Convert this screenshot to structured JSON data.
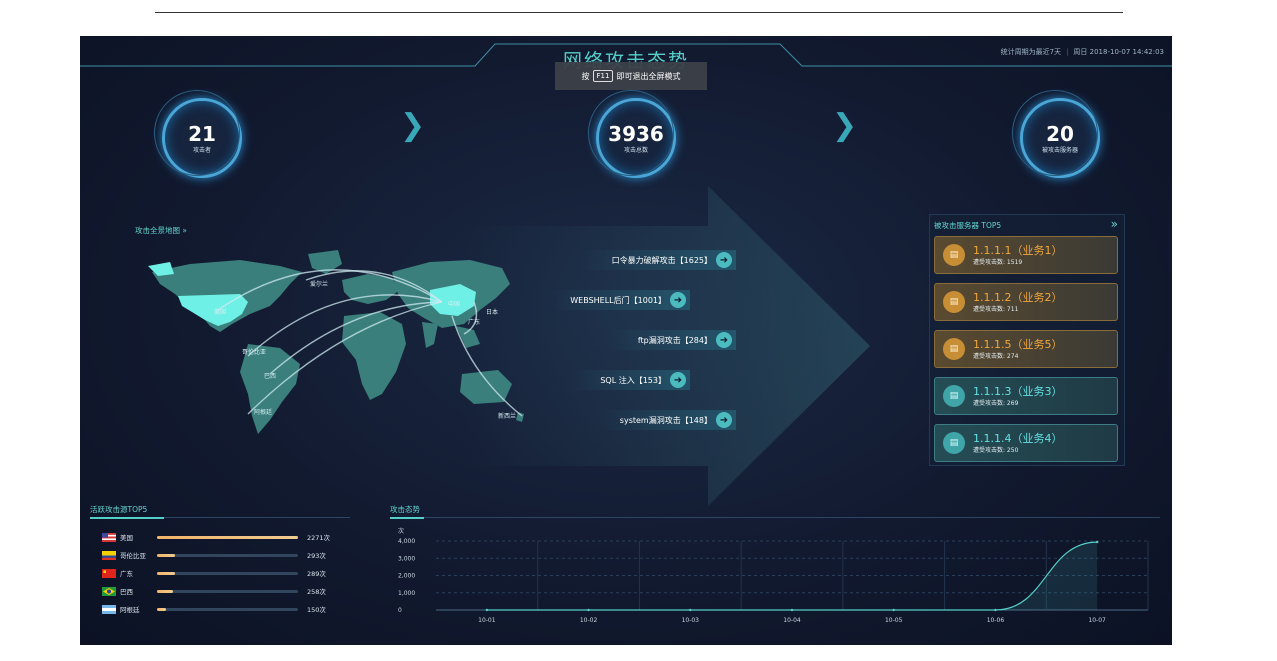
{
  "dashboard": {
    "title": "网络攻击态势",
    "stat_period": "统计周期为最近7天",
    "datetime": "周日 2018-10-07 14:42:03",
    "fullscreen_tip": {
      "prefix": "按",
      "key": "F11",
      "suffix": "即可退出全屏模式"
    }
  },
  "stats": [
    {
      "value": "21",
      "label": "攻击者"
    },
    {
      "value": "3936",
      "label": "攻击总数"
    },
    {
      "value": "20",
      "label": "被攻击服务器"
    }
  ],
  "map": {
    "title": "攻击全景地图",
    "places": [
      "美国",
      "爱尔兰",
      "中国",
      "日本",
      "广东",
      "哥伦比亚",
      "巴西",
      "阿根廷",
      "新西兰"
    ]
  },
  "attack_types": [
    {
      "label": "口令暴力破解攻击【1625】"
    },
    {
      "label": "WEBSHELL后门【1001】"
    },
    {
      "label": "ftp漏洞攻击【284】"
    },
    {
      "label": "SQL 注入【153】"
    },
    {
      "label": "system漏洞攻击【148】"
    }
  ],
  "servers": {
    "title": "被攻击服务器 TOP5",
    "items": [
      {
        "name": "1.1.1.1（业务1）",
        "count_text": "遭受攻击数: 1519",
        "color": "orange"
      },
      {
        "name": "1.1.1.2（业务2）",
        "count_text": "遭受攻击数: 711",
        "color": "orange"
      },
      {
        "name": "1.1.1.5（业务5）",
        "count_text": "遭受攻击数: 274",
        "color": "orange"
      },
      {
        "name": "1.1.1.3（业务3）",
        "count_text": "遭受攻击数: 269",
        "color": "teal"
      },
      {
        "name": "1.1.1.4（业务4）",
        "count_text": "遭受攻击数: 250",
        "color": "teal"
      }
    ]
  },
  "sources": {
    "title": "活跃攻击源TOP5",
    "items": [
      {
        "name": "美国",
        "count": 2271,
        "count_text": "2271次",
        "flag": "us-flag"
      },
      {
        "name": "哥伦比亚",
        "count": 293,
        "count_text": "293次",
        "flag": "colombia-flag"
      },
      {
        "name": "广东",
        "count": 289,
        "count_text": "289次",
        "flag": "china-flag"
      },
      {
        "name": "巴西",
        "count": 258,
        "count_text": "258次",
        "flag": "brazil-flag"
      },
      {
        "name": "阿根廷",
        "count": 150,
        "count_text": "150次",
        "flag": "argentina-flag"
      }
    ]
  },
  "trend": {
    "title": "攻击态势"
  },
  "chart_data": {
    "type": "area",
    "x": [
      "10-01",
      "10-02",
      "10-03",
      "10-04",
      "10-05",
      "10-06",
      "10-07"
    ],
    "series": [
      {
        "values": [
          0,
          0,
          0,
          0,
          0,
          0,
          3936
        ]
      }
    ],
    "ylabel": "次",
    "yticks": [
      "0",
      "1,000",
      "2,000",
      "3,000",
      "4,000"
    ],
    "ylim": [
      0,
      4000
    ],
    "grid": true
  },
  "colors": {
    "accent": "#53d0c8",
    "orange": "#f2a73b",
    "teal": "#63e1e0"
  }
}
